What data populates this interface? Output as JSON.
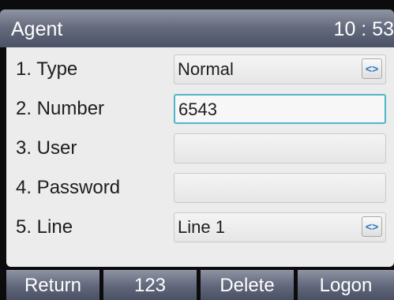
{
  "header": {
    "title": "Agent",
    "time": "10 : 53"
  },
  "form": {
    "rows": [
      {
        "label": "1.  Type",
        "value": "Normal",
        "control": "switch-icon"
      },
      {
        "label": "2.  Number",
        "value": "6543",
        "focused": true
      },
      {
        "label": "3.  User",
        "value": ""
      },
      {
        "label": "4.  Password",
        "value": ""
      },
      {
        "label": "5.  Line",
        "value": "Line 1",
        "control": "switch-icon"
      }
    ],
    "switch_glyph": "<>"
  },
  "softkeys": [
    {
      "label": "Return"
    },
    {
      "label": "123"
    },
    {
      "label": "Delete"
    },
    {
      "label": "Logon"
    }
  ],
  "colors": {
    "accent": "#4fb6c8",
    "switch_arrow": "#2a79c7",
    "bar": "#656b7d"
  }
}
